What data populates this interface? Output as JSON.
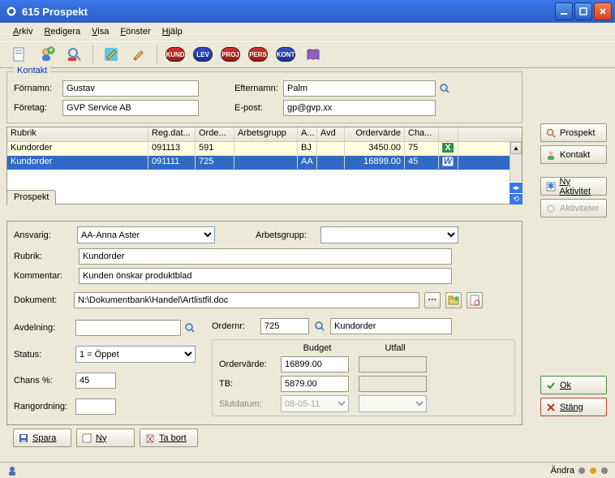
{
  "window": {
    "title": "615 Prospekt"
  },
  "menu": {
    "items": [
      "Arkiv",
      "Redigera",
      "Visa",
      "Fönster",
      "Hjälp"
    ]
  },
  "toolbar_badges": [
    "KUND",
    "LEV",
    "PROJ",
    "PERS",
    "KONT"
  ],
  "sidebar": {
    "prospekt": "Prospekt",
    "kontakt": "Kontakt",
    "ny_aktivitet": "Ny Aktivitet",
    "aktiviteter": "Aktiviteter",
    "ok": "Ok",
    "stang": "Stäng"
  },
  "kontakt": {
    "legend": "Kontakt",
    "fornamn_lbl": "Förnamn:",
    "fornamn_val": "Gustav",
    "efternamn_lbl": "Efternamn:",
    "efternamn_val": "Palm",
    "foretag_lbl": "Företag:",
    "foretag_val": "GVP Service AB",
    "epost_lbl": "E-post:",
    "epost_val": "gp@gvp.xx"
  },
  "grid": {
    "headers": [
      "Rubrik",
      "Reg.dat...",
      "Orde...",
      "Arbetsgrupp",
      "A...",
      "Avd",
      "Ordervärde",
      "Cha..."
    ],
    "rows": [
      {
        "rubrik": "Kundorder",
        "reg": "091113",
        "ord": "591",
        "grp": "",
        "a": "BJ",
        "avd": "",
        "varde": "3450.00",
        "cha": "75",
        "icon": "excel"
      },
      {
        "rubrik": "Kundorder",
        "reg": "091111",
        "ord": "725",
        "grp": "",
        "a": "AA",
        "avd": "",
        "varde": "16899.00",
        "cha": "45",
        "icon": "word"
      }
    ]
  },
  "prospekt": {
    "tab": "Prospekt",
    "ansvarig_lbl": "Ansvarig:",
    "ansvarig_val": "AA-Anna Aster",
    "arbetsgrupp_lbl": "Arbetsgrupp:",
    "rubrik_lbl": "Rubrik:",
    "rubrik_val": "Kundorder",
    "kommentar_lbl": "Kommentar:",
    "kommentar_val": "Kunden önskar produktblad",
    "dokument_lbl": "Dokument:",
    "dokument_val": "N:\\Dokumentbank\\Handel\\Artlistfil.doc",
    "avdelning_lbl": "Avdelning:",
    "ordernr_lbl": "Ordernr:",
    "ordernr_val": "725",
    "ordernr_ref": "Kundorder",
    "status_lbl": "Status:",
    "status_val": "1 = Öppet",
    "chans_lbl": "Chans %:",
    "chans_val": "45",
    "rang_lbl": "Rangordning:",
    "budget_lbl": "Budget",
    "utfall_lbl": "Utfall",
    "ordervarde_lbl": "Ordervärde:",
    "ordervarde_val": "16899.00",
    "tb_lbl": "TB:",
    "tb_val": "5879.00",
    "slutdatum_lbl": "Slutdatum:",
    "slutdatum_val": "08-05-11"
  },
  "bottom": {
    "spara": "Spara",
    "ny": "Ny",
    "tabort": "Ta bort"
  },
  "status": {
    "andra": "Ändra"
  }
}
